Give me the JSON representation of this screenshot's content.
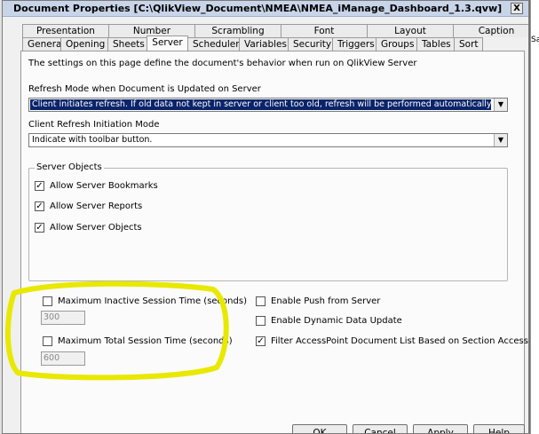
{
  "window": {
    "title": "Document Properties [C:\\QlikView_Document\\NMEA\\NMEA_iManage_Dashboard_1.3.qvw]",
    "close_label": "X"
  },
  "tabs_top": [
    "Presentation",
    "Number",
    "Scrambling",
    "Font",
    "Layout",
    "Caption"
  ],
  "tabs_bottom": [
    "General",
    "Opening",
    "Sheets",
    "Server",
    "Scheduler",
    "Variables",
    "Security",
    "Triggers",
    "Groups",
    "Tables",
    "Sort"
  ],
  "active_tab": "Server",
  "panel": {
    "description": "The settings on this page define the document's behavior when run on QlikView Server",
    "refresh_mode": {
      "label": "Refresh Mode when Document is Updated on Server",
      "value": "Client initiates refresh. If old data not kept in server or client too old, refresh will be performed automatically."
    },
    "client_refresh": {
      "label": "Client Refresh Initiation Mode",
      "value": "Indicate with toolbar button."
    },
    "server_objects": {
      "legend": "Server Objects",
      "items": [
        {
          "label": "Allow Server Bookmarks",
          "checked": true
        },
        {
          "label": "Allow Server Reports",
          "checked": true
        },
        {
          "label": "Allow Server Objects",
          "checked": true
        }
      ]
    },
    "session": {
      "inactive_label": "Maximum Inactive Session Time (seconds)",
      "inactive_checked": false,
      "inactive_value": "300",
      "total_label": "Maximum Total Session Time (seconds)",
      "total_checked": false,
      "total_value": "600"
    },
    "right_options": [
      {
        "label": "Enable Push from Server",
        "checked": false
      },
      {
        "label": "Enable Dynamic Data Update",
        "checked": false
      },
      {
        "label": "Filter AccessPoint Document List Based on Section Access",
        "checked": true
      }
    ]
  },
  "buttons": {
    "ok": "OK",
    "cancel": "Cancel",
    "apply": "Apply",
    "help": "Help"
  },
  "background_window_text": "Sa",
  "highlight_color": "#e8e800"
}
